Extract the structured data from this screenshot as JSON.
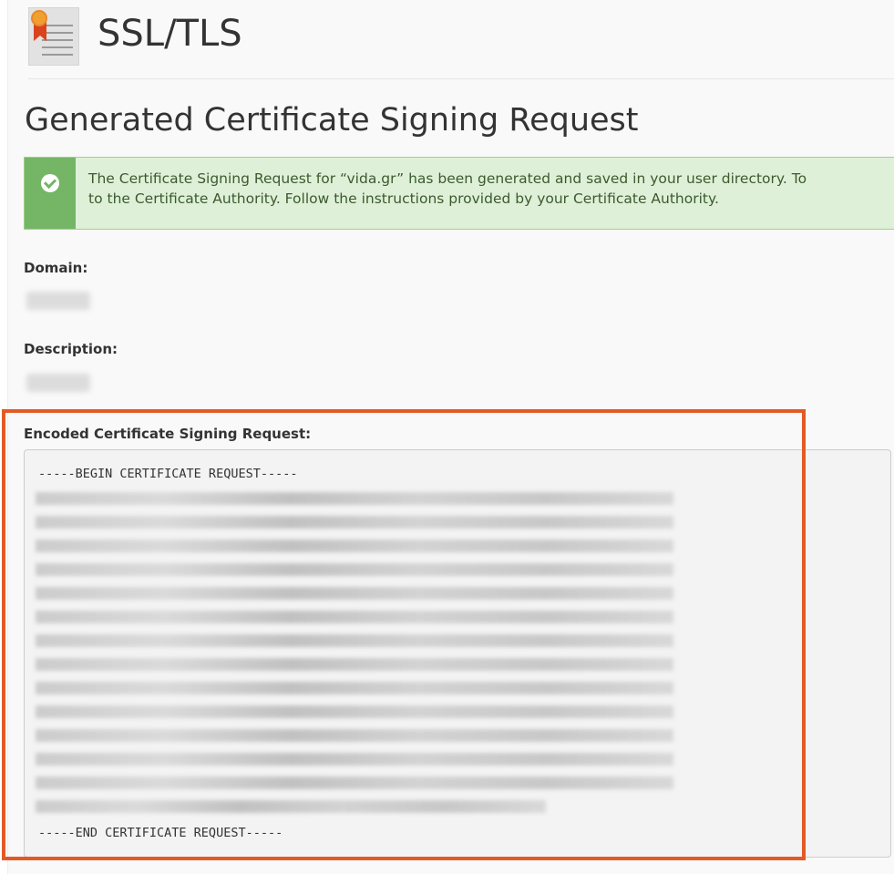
{
  "header": {
    "title": "SSL/TLS",
    "icon": "ssl-certificate-icon"
  },
  "page": {
    "heading": "Generated Certificate Signing Request"
  },
  "alert": {
    "icon": "check-circle-icon",
    "line1": "The Certificate Signing Request for “vida.gr” has been generated and saved in your user directory. To",
    "line2": "to the Certificate Authority. Follow the instructions provided by your Certificate Authority.",
    "color": "#74b566"
  },
  "fields": {
    "domain_label": "Domain:",
    "description_label": "Description:"
  },
  "csr": {
    "label": "Encoded Certificate Signing Request:",
    "begin": "-----BEGIN CERTIFICATE REQUEST-----",
    "end": "-----END CERTIFICATE REQUEST-----"
  },
  "colors": {
    "highlight": "#e35a24",
    "alert_bg": "#dff0d8"
  }
}
